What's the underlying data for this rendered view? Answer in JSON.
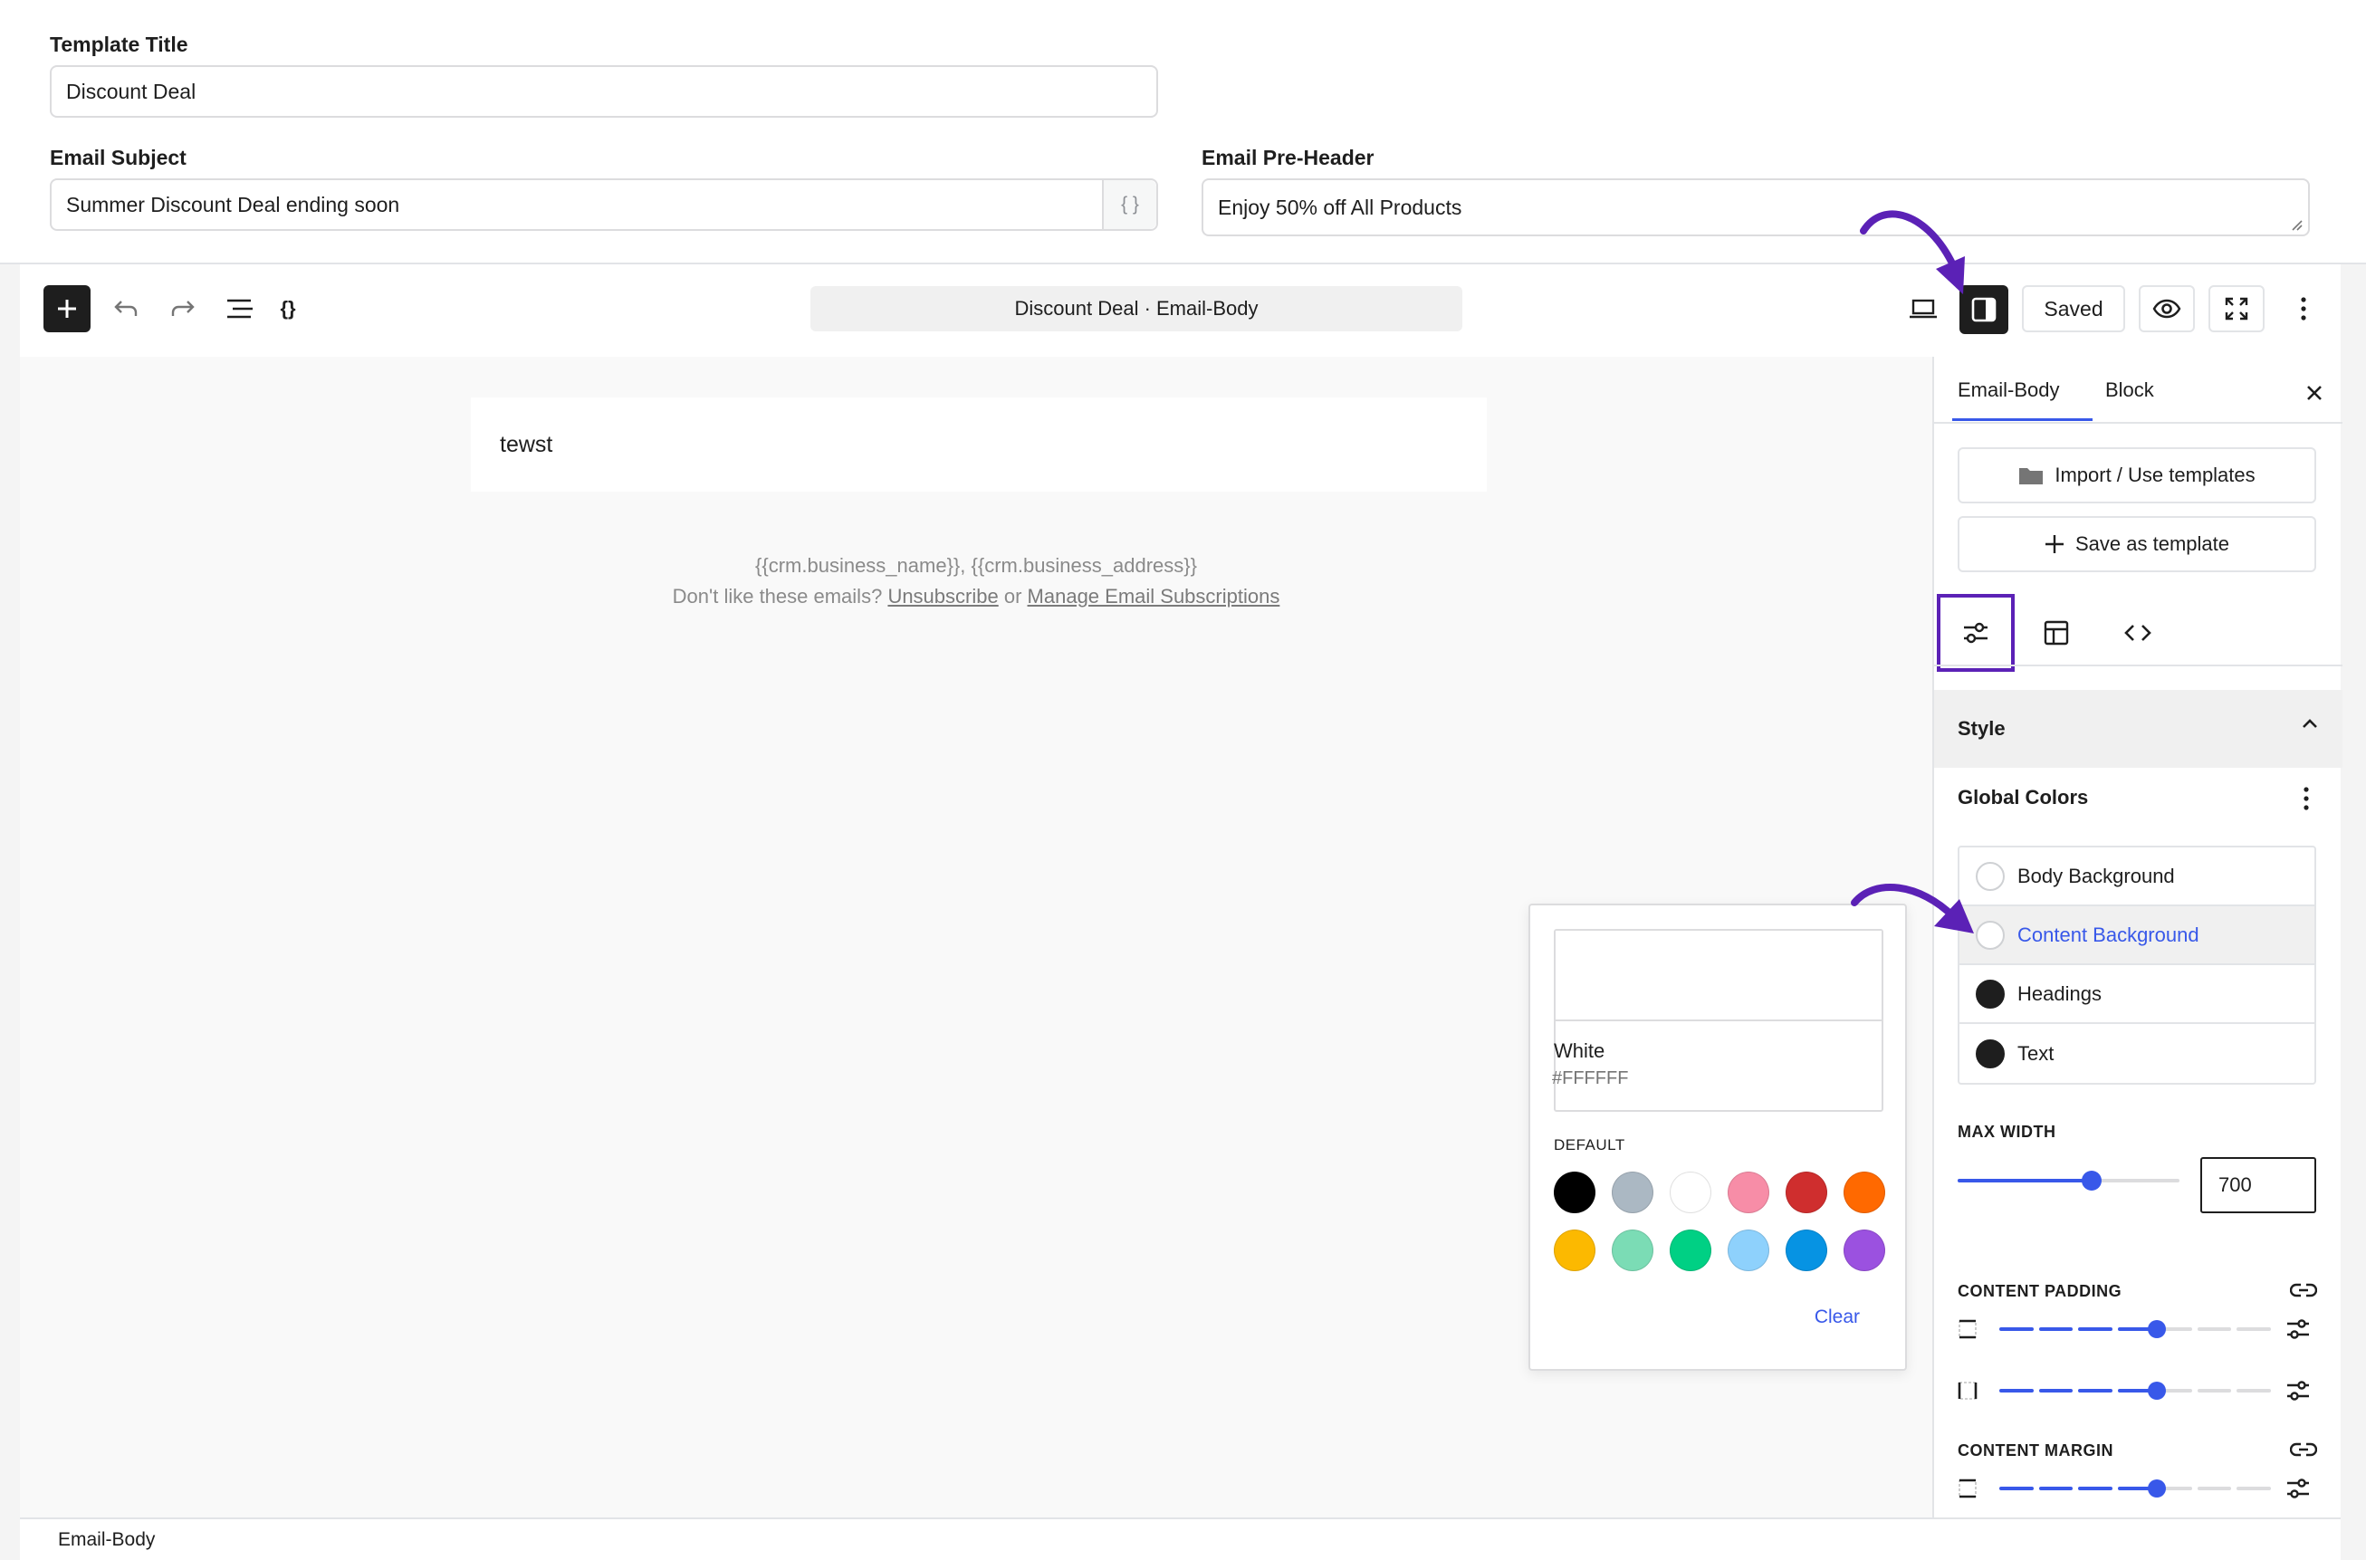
{
  "form": {
    "template_title_label": "Template Title",
    "template_title_value": "Discount Deal",
    "email_subject_label": "Email Subject",
    "email_subject_value": "Summer Discount Deal ending soon",
    "smartcode_label": "{ }",
    "preheader_label": "Email Pre-Header",
    "preheader_value": "Enjoy 50% off All Products"
  },
  "toolbar": {
    "add_icon": "plus-icon",
    "undo_icon": "undo-icon",
    "redo_icon": "redo-icon",
    "outline_icon": "list-view-icon",
    "code_icon": "curly-braces-icon",
    "document_title": "Discount Deal · Email-Body",
    "saved_label": "Saved"
  },
  "canvas": {
    "block_text": "tewst",
    "footer_line1": "{{crm.business_name}}, {{crm.business_address}}",
    "footer_prefix": "Don't like these emails?",
    "unsubscribe_label": "Unsubscribe",
    "footer_or": "or",
    "manage_label": "Manage Email Subscriptions"
  },
  "color_popover": {
    "selected_name": "White",
    "selected_hex": "#FFFFFF",
    "default_label": "DEFAULT",
    "swatches": [
      "#000000",
      "#abb8c3",
      "#ffffff",
      "#f78da7",
      "#cf2e2e",
      "#ff6900",
      "#fcb900",
      "#7bdcb5",
      "#00d084",
      "#8ed1fc",
      "#0693e3",
      "#9b51e0"
    ],
    "clear_label": "Clear"
  },
  "sidebar": {
    "tabs": [
      {
        "label": "Email-Body",
        "active": true
      },
      {
        "label": "Block",
        "active": false
      }
    ],
    "import_label": "Import / Use templates",
    "save_template_label": "Save as template",
    "style_label": "Style",
    "global_colors_label": "Global Colors",
    "colors": [
      {
        "label": "Body Background",
        "value": "#ffffff"
      },
      {
        "label": "Content Background",
        "value": "#ffffff",
        "selected": true
      },
      {
        "label": "Headings",
        "value": "#1e1e1e"
      },
      {
        "label": "Text",
        "value": "#1e1e1e"
      }
    ],
    "max_width_label": "MAX WIDTH",
    "max_width_value": "700",
    "content_padding_label": "CONTENT PADDING",
    "content_margin_label": "CONTENT MARGIN"
  },
  "status_bar": {
    "breadcrumb": "Email-Body"
  },
  "accent_color": "#3858e9",
  "annotation_color": "#5b21b6"
}
